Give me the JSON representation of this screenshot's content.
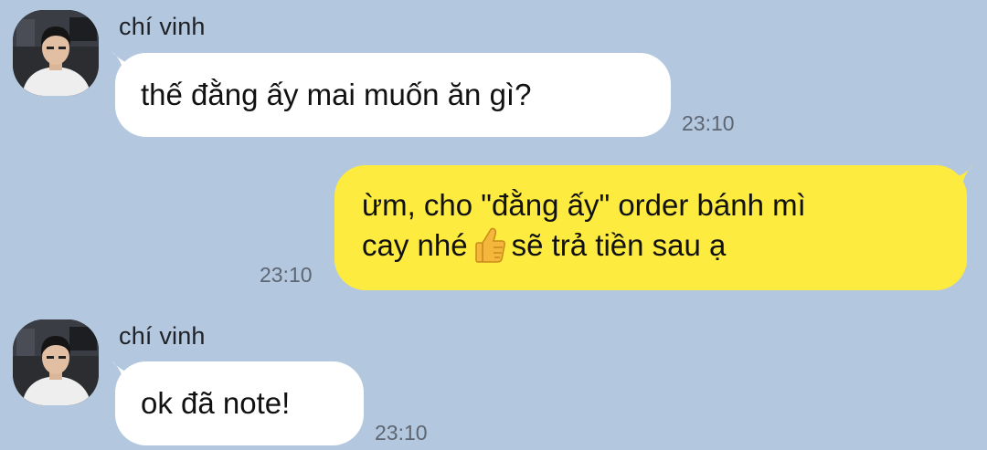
{
  "conversation": {
    "messages": [
      {
        "sender": "chí vinh",
        "direction": "incoming",
        "text": "thế đằng ấy mai muốn ăn gì?",
        "time": "23:10"
      },
      {
        "direction": "outgoing",
        "line1": "ừm, cho \"đằng ấy\" order bánh mì",
        "line2_before": "cay nhé",
        "emoji": "thumbs-up-icon",
        "line2_after": "sẽ trả tiền sau ạ",
        "time": "23:10"
      },
      {
        "sender": "chí vinh",
        "direction": "incoming",
        "text": "ok đã note!",
        "time": "23:10"
      }
    ]
  },
  "colors": {
    "background": "#b3c7de",
    "incoming_bubble": "#ffffff",
    "outgoing_bubble": "#fdeb3f",
    "timestamp": "#5d6672"
  }
}
